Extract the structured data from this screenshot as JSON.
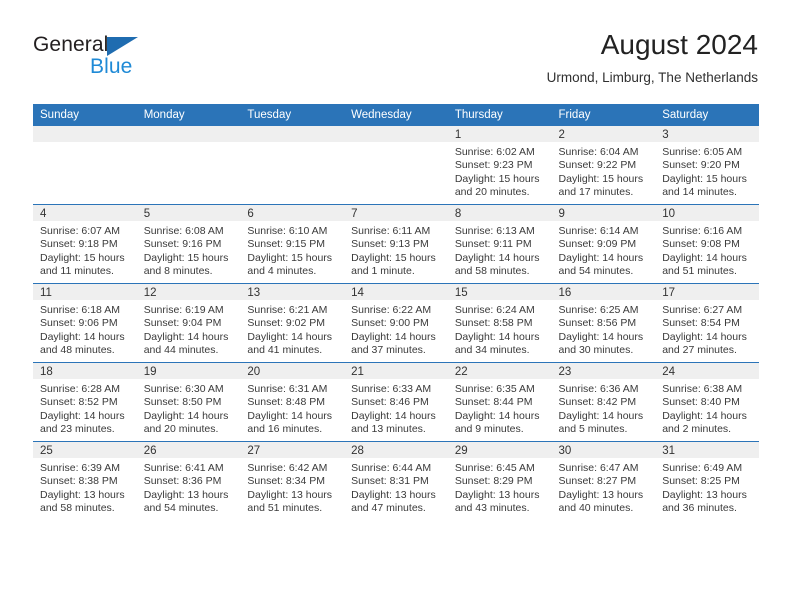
{
  "brand": {
    "word_one": "General",
    "word_two": "Blue",
    "triangle_color": "#1f6cb0",
    "blue_color": "#1f8ad6",
    "dark_color": "#231f20"
  },
  "header": {
    "title": "August 2024",
    "subtitle": "Urmond, Limburg, The Netherlands"
  },
  "theme": {
    "header_bar": "#2b74b8",
    "daynum_band": "#efefef",
    "text": "#333333"
  },
  "calendar": {
    "weekday_headers": [
      "Sunday",
      "Monday",
      "Tuesday",
      "Wednesday",
      "Thursday",
      "Friday",
      "Saturday"
    ],
    "weeks": [
      [
        {
          "day": "",
          "empty": true,
          "sunrise": "",
          "sunset": "",
          "daylight_1": "",
          "daylight_2": ""
        },
        {
          "day": "",
          "empty": true,
          "sunrise": "",
          "sunset": "",
          "daylight_1": "",
          "daylight_2": ""
        },
        {
          "day": "",
          "empty": true,
          "sunrise": "",
          "sunset": "",
          "daylight_1": "",
          "daylight_2": ""
        },
        {
          "day": "",
          "empty": true,
          "sunrise": "",
          "sunset": "",
          "daylight_1": "",
          "daylight_2": ""
        },
        {
          "day": "1",
          "empty": false,
          "sunrise": "Sunrise: 6:02 AM",
          "sunset": "Sunset: 9:23 PM",
          "daylight_1": "Daylight: 15 hours",
          "daylight_2": "and 20 minutes."
        },
        {
          "day": "2",
          "empty": false,
          "sunrise": "Sunrise: 6:04 AM",
          "sunset": "Sunset: 9:22 PM",
          "daylight_1": "Daylight: 15 hours",
          "daylight_2": "and 17 minutes."
        },
        {
          "day": "3",
          "empty": false,
          "sunrise": "Sunrise: 6:05 AM",
          "sunset": "Sunset: 9:20 PM",
          "daylight_1": "Daylight: 15 hours",
          "daylight_2": "and 14 minutes."
        }
      ],
      [
        {
          "day": "4",
          "empty": false,
          "sunrise": "Sunrise: 6:07 AM",
          "sunset": "Sunset: 9:18 PM",
          "daylight_1": "Daylight: 15 hours",
          "daylight_2": "and 11 minutes."
        },
        {
          "day": "5",
          "empty": false,
          "sunrise": "Sunrise: 6:08 AM",
          "sunset": "Sunset: 9:16 PM",
          "daylight_1": "Daylight: 15 hours",
          "daylight_2": "and 8 minutes."
        },
        {
          "day": "6",
          "empty": false,
          "sunrise": "Sunrise: 6:10 AM",
          "sunset": "Sunset: 9:15 PM",
          "daylight_1": "Daylight: 15 hours",
          "daylight_2": "and 4 minutes."
        },
        {
          "day": "7",
          "empty": false,
          "sunrise": "Sunrise: 6:11 AM",
          "sunset": "Sunset: 9:13 PM",
          "daylight_1": "Daylight: 15 hours",
          "daylight_2": "and 1 minute."
        },
        {
          "day": "8",
          "empty": false,
          "sunrise": "Sunrise: 6:13 AM",
          "sunset": "Sunset: 9:11 PM",
          "daylight_1": "Daylight: 14 hours",
          "daylight_2": "and 58 minutes."
        },
        {
          "day": "9",
          "empty": false,
          "sunrise": "Sunrise: 6:14 AM",
          "sunset": "Sunset: 9:09 PM",
          "daylight_1": "Daylight: 14 hours",
          "daylight_2": "and 54 minutes."
        },
        {
          "day": "10",
          "empty": false,
          "sunrise": "Sunrise: 6:16 AM",
          "sunset": "Sunset: 9:08 PM",
          "daylight_1": "Daylight: 14 hours",
          "daylight_2": "and 51 minutes."
        }
      ],
      [
        {
          "day": "11",
          "empty": false,
          "sunrise": "Sunrise: 6:18 AM",
          "sunset": "Sunset: 9:06 PM",
          "daylight_1": "Daylight: 14 hours",
          "daylight_2": "and 48 minutes."
        },
        {
          "day": "12",
          "empty": false,
          "sunrise": "Sunrise: 6:19 AM",
          "sunset": "Sunset: 9:04 PM",
          "daylight_1": "Daylight: 14 hours",
          "daylight_2": "and 44 minutes."
        },
        {
          "day": "13",
          "empty": false,
          "sunrise": "Sunrise: 6:21 AM",
          "sunset": "Sunset: 9:02 PM",
          "daylight_1": "Daylight: 14 hours",
          "daylight_2": "and 41 minutes."
        },
        {
          "day": "14",
          "empty": false,
          "sunrise": "Sunrise: 6:22 AM",
          "sunset": "Sunset: 9:00 PM",
          "daylight_1": "Daylight: 14 hours",
          "daylight_2": "and 37 minutes."
        },
        {
          "day": "15",
          "empty": false,
          "sunrise": "Sunrise: 6:24 AM",
          "sunset": "Sunset: 8:58 PM",
          "daylight_1": "Daylight: 14 hours",
          "daylight_2": "and 34 minutes."
        },
        {
          "day": "16",
          "empty": false,
          "sunrise": "Sunrise: 6:25 AM",
          "sunset": "Sunset: 8:56 PM",
          "daylight_1": "Daylight: 14 hours",
          "daylight_2": "and 30 minutes."
        },
        {
          "day": "17",
          "empty": false,
          "sunrise": "Sunrise: 6:27 AM",
          "sunset": "Sunset: 8:54 PM",
          "daylight_1": "Daylight: 14 hours",
          "daylight_2": "and 27 minutes."
        }
      ],
      [
        {
          "day": "18",
          "empty": false,
          "sunrise": "Sunrise: 6:28 AM",
          "sunset": "Sunset: 8:52 PM",
          "daylight_1": "Daylight: 14 hours",
          "daylight_2": "and 23 minutes."
        },
        {
          "day": "19",
          "empty": false,
          "sunrise": "Sunrise: 6:30 AM",
          "sunset": "Sunset: 8:50 PM",
          "daylight_1": "Daylight: 14 hours",
          "daylight_2": "and 20 minutes."
        },
        {
          "day": "20",
          "empty": false,
          "sunrise": "Sunrise: 6:31 AM",
          "sunset": "Sunset: 8:48 PM",
          "daylight_1": "Daylight: 14 hours",
          "daylight_2": "and 16 minutes."
        },
        {
          "day": "21",
          "empty": false,
          "sunrise": "Sunrise: 6:33 AM",
          "sunset": "Sunset: 8:46 PM",
          "daylight_1": "Daylight: 14 hours",
          "daylight_2": "and 13 minutes."
        },
        {
          "day": "22",
          "empty": false,
          "sunrise": "Sunrise: 6:35 AM",
          "sunset": "Sunset: 8:44 PM",
          "daylight_1": "Daylight: 14 hours",
          "daylight_2": "and 9 minutes."
        },
        {
          "day": "23",
          "empty": false,
          "sunrise": "Sunrise: 6:36 AM",
          "sunset": "Sunset: 8:42 PM",
          "daylight_1": "Daylight: 14 hours",
          "daylight_2": "and 5 minutes."
        },
        {
          "day": "24",
          "empty": false,
          "sunrise": "Sunrise: 6:38 AM",
          "sunset": "Sunset: 8:40 PM",
          "daylight_1": "Daylight: 14 hours",
          "daylight_2": "and 2 minutes."
        }
      ],
      [
        {
          "day": "25",
          "empty": false,
          "sunrise": "Sunrise: 6:39 AM",
          "sunset": "Sunset: 8:38 PM",
          "daylight_1": "Daylight: 13 hours",
          "daylight_2": "and 58 minutes."
        },
        {
          "day": "26",
          "empty": false,
          "sunrise": "Sunrise: 6:41 AM",
          "sunset": "Sunset: 8:36 PM",
          "daylight_1": "Daylight: 13 hours",
          "daylight_2": "and 54 minutes."
        },
        {
          "day": "27",
          "empty": false,
          "sunrise": "Sunrise: 6:42 AM",
          "sunset": "Sunset: 8:34 PM",
          "daylight_1": "Daylight: 13 hours",
          "daylight_2": "and 51 minutes."
        },
        {
          "day": "28",
          "empty": false,
          "sunrise": "Sunrise: 6:44 AM",
          "sunset": "Sunset: 8:31 PM",
          "daylight_1": "Daylight: 13 hours",
          "daylight_2": "and 47 minutes."
        },
        {
          "day": "29",
          "empty": false,
          "sunrise": "Sunrise: 6:45 AM",
          "sunset": "Sunset: 8:29 PM",
          "daylight_1": "Daylight: 13 hours",
          "daylight_2": "and 43 minutes."
        },
        {
          "day": "30",
          "empty": false,
          "sunrise": "Sunrise: 6:47 AM",
          "sunset": "Sunset: 8:27 PM",
          "daylight_1": "Daylight: 13 hours",
          "daylight_2": "and 40 minutes."
        },
        {
          "day": "31",
          "empty": false,
          "sunrise": "Sunrise: 6:49 AM",
          "sunset": "Sunset: 8:25 PM",
          "daylight_1": "Daylight: 13 hours",
          "daylight_2": "and 36 minutes."
        }
      ]
    ]
  }
}
